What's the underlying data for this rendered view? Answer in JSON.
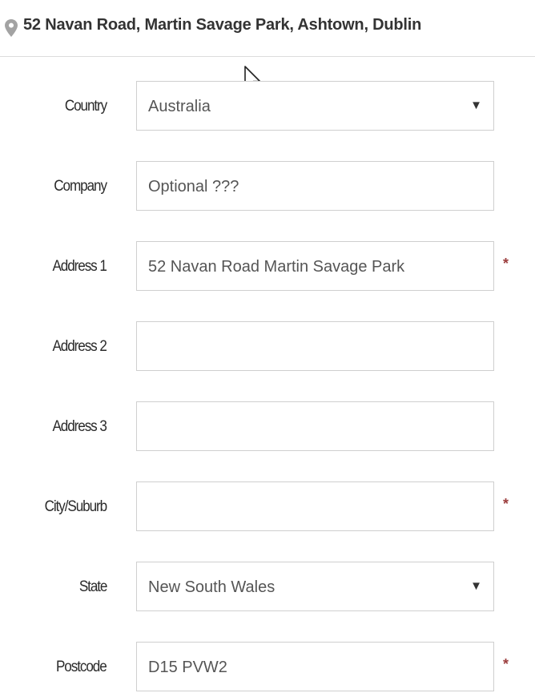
{
  "header": {
    "address": "52 Navan Road, Martin Savage Park, Ashtown, Dublin",
    "icon": "location-pin-icon"
  },
  "form": {
    "required_marker": "*",
    "fields": [
      {
        "label": "Country",
        "value": "Australia",
        "type": "select",
        "required": false
      },
      {
        "label": "Company",
        "value": "",
        "placeholder": "Optional ???",
        "type": "text",
        "required": false
      },
      {
        "label": "Address 1",
        "value": "52 Navan Road Martin Savage Park",
        "type": "text",
        "required": true
      },
      {
        "label": "Address 2",
        "value": "",
        "type": "text",
        "required": false
      },
      {
        "label": "Address 3",
        "value": "",
        "type": "text",
        "required": false
      },
      {
        "label": "City/Suburb",
        "value": "",
        "type": "text",
        "required": true
      },
      {
        "label": "State",
        "value": "New South Wales",
        "type": "select",
        "required": false
      },
      {
        "label": "Postcode",
        "value": "D15 PVW2",
        "type": "text",
        "required": true
      }
    ]
  },
  "colors": {
    "border": "#cfcfcf",
    "required": "#9b3d3d",
    "pin": "#9e9e9e"
  }
}
